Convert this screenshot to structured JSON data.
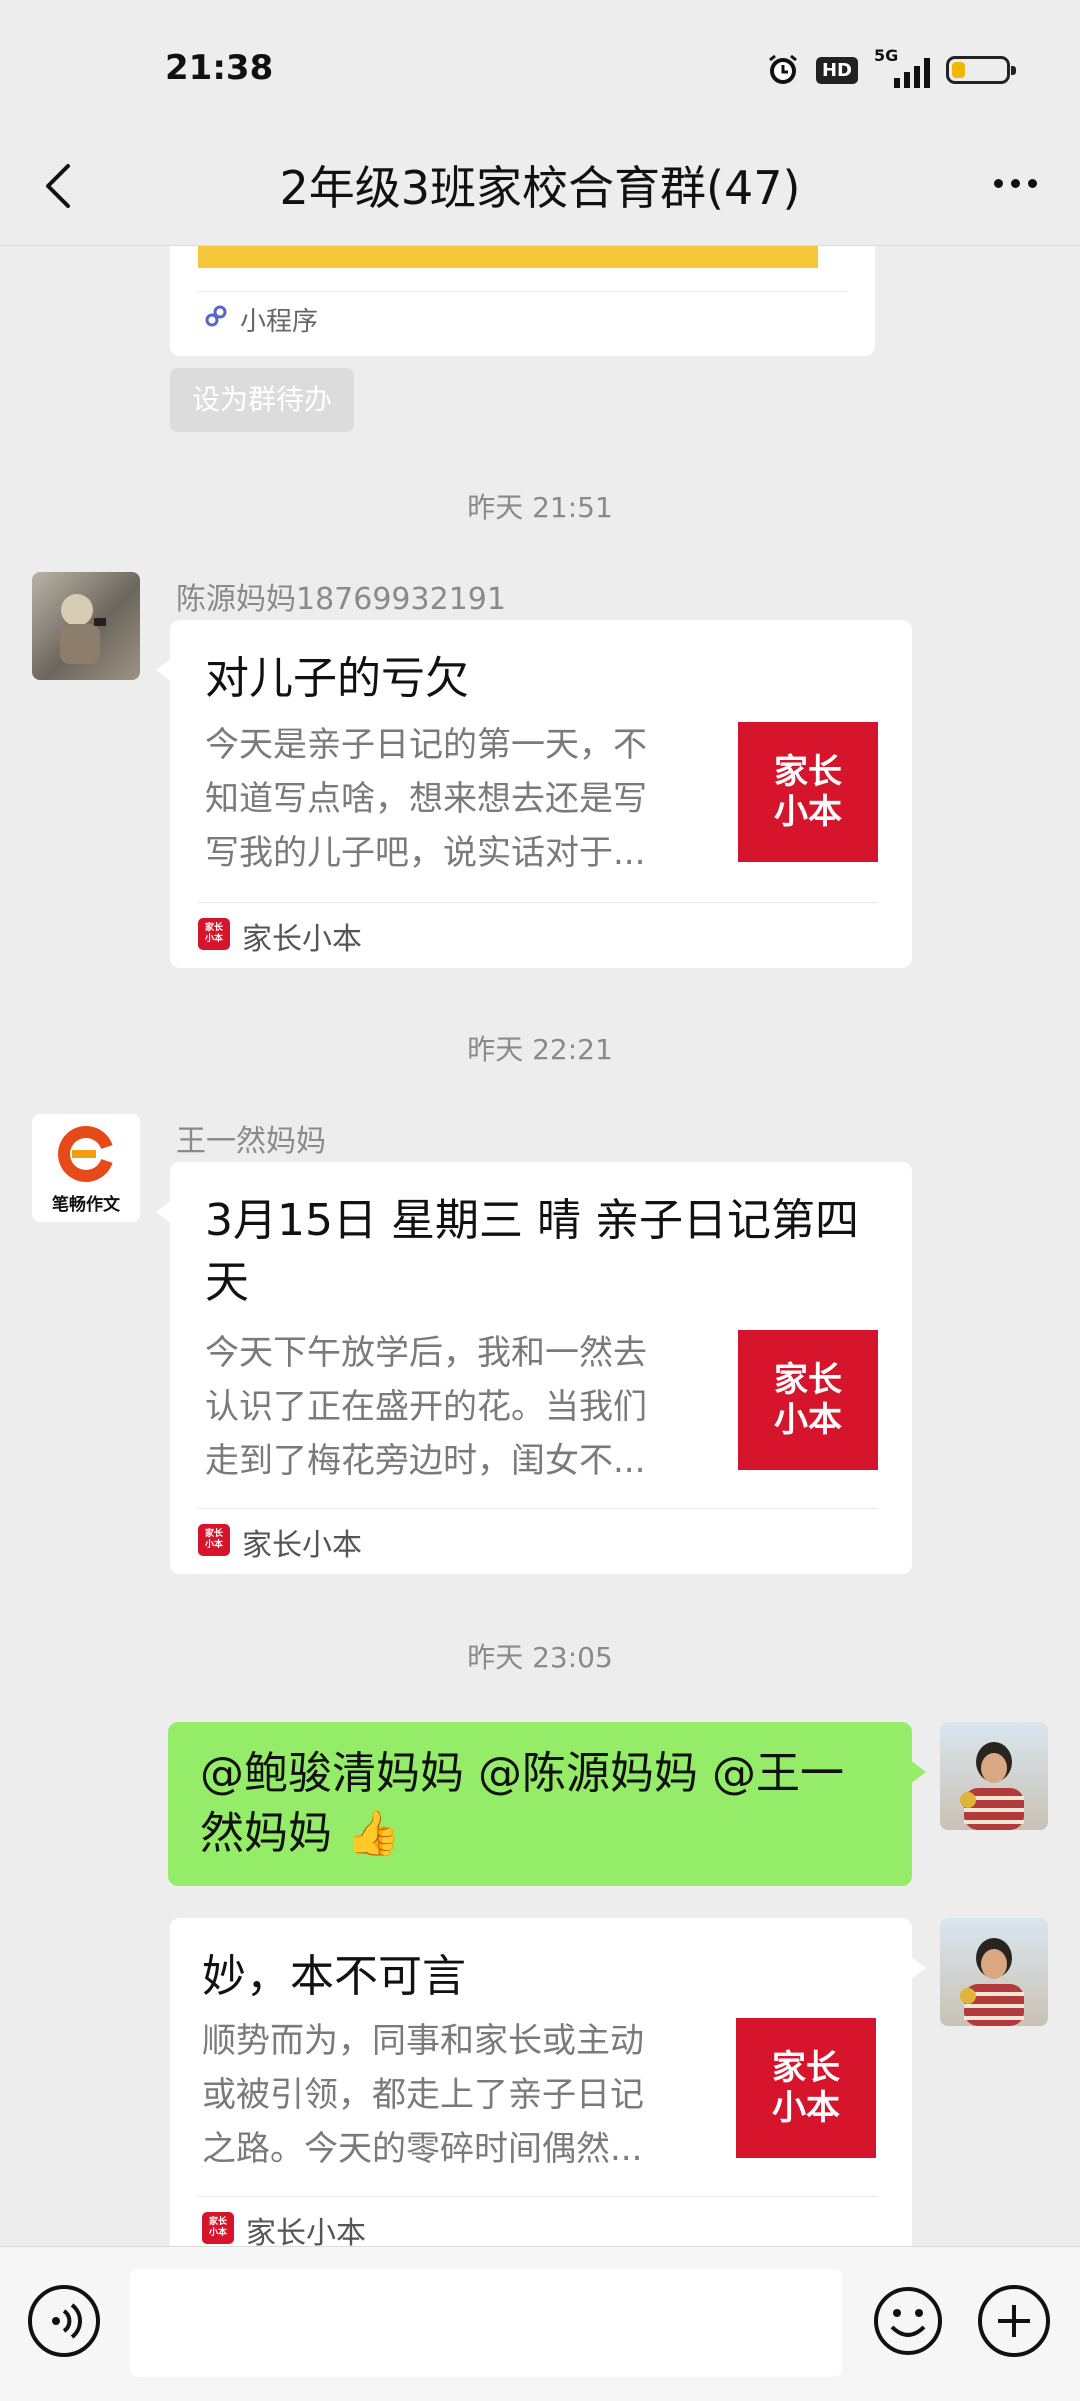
{
  "status_bar": {
    "time": "21:38",
    "hd_label": "HD",
    "network_label": "5G",
    "battery_level": 0.25,
    "battery_color": "#f2b705"
  },
  "nav": {
    "back_icon": "chevron-left-icon",
    "title": "2年级3班家校合育群(47)",
    "more_icon": "more-dots-icon"
  },
  "messages": {
    "mini_program": {
      "label": "小程序",
      "todo_button": "设为群待办"
    },
    "timestamp_1": "昨天 21:51",
    "msg_chenyuan": {
      "sender": "陈源妈妈18769932191",
      "title": "对儿子的亏欠",
      "desc_lines": [
        "今天是亲子日记的第一天，不",
        "知道写点啥，想来想去还是写",
        "写我的儿子吧，说实话对于..."
      ],
      "thumb_line1": "家长",
      "thumb_line2": "小本",
      "source": "家长小本"
    },
    "timestamp_2": "昨天 22:21",
    "msg_wangyiran": {
      "sender": "王一然妈妈",
      "avatar_text": "笔畅作文",
      "title": "3月15日  星期三   晴  亲子日记第四天",
      "desc_lines": [
        "今天下午放学后，我和一然去",
        "认识了正在盛开的花。当我们",
        "走到了梅花旁边时，闺女不..."
      ],
      "thumb_line1": "家长",
      "thumb_line2": "小本",
      "source": "家长小本"
    },
    "timestamp_3": "昨天 23:05",
    "msg_self_text": {
      "text": "@鲍骏清妈妈 @陈源妈妈 @王一然妈妈 👍"
    },
    "msg_self_article": {
      "title": "妙，本不可言",
      "desc_lines": [
        "顺势而为，同事和家长或主动",
        "或被引领，都走上了亲子日记",
        "之路。今天的零碎时间偶然..."
      ],
      "thumb_line1": "家长",
      "thumb_line2": "小本",
      "source": "家长小本"
    },
    "source_icon_text": "家长\n小本"
  },
  "input_bar": {
    "voice_icon": "voice-icon",
    "input_value": "",
    "emoji_icon": "emoji-icon",
    "plus_icon": "plus-icon"
  }
}
